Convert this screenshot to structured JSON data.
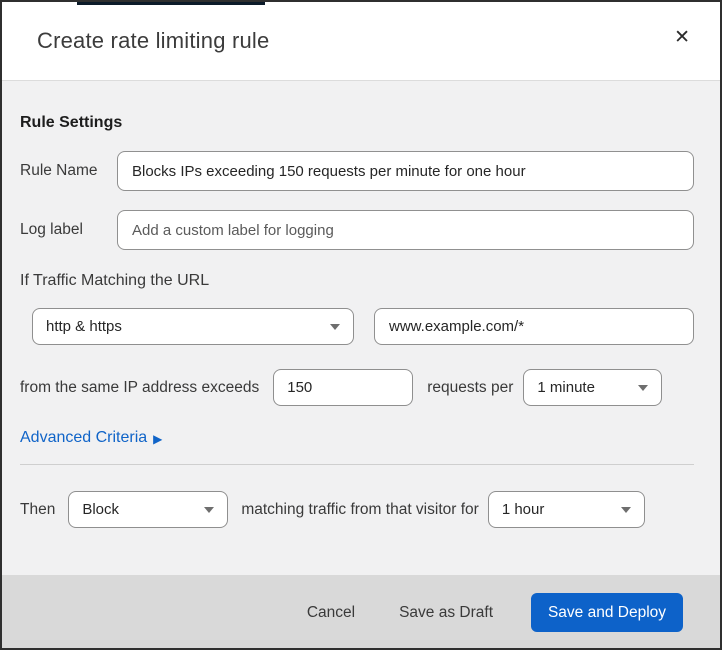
{
  "dialog": {
    "title": "Create rate limiting rule",
    "close_icon": "✕"
  },
  "rule_settings": {
    "section_heading": "Rule Settings",
    "rule_name": {
      "label": "Rule Name",
      "value": "Blocks IPs exceeding 150 requests per minute for one hour"
    },
    "log_label": {
      "label": "Log label",
      "placeholder": "Add a custom label for logging"
    },
    "traffic_match_heading": "If Traffic Matching the URL",
    "scheme_select": {
      "value": "http & https"
    },
    "url_input": {
      "value": "www.example.com/*"
    },
    "threshold": {
      "prefix_text": "from the same IP address exceeds",
      "count_value": "150",
      "middle_text": "requests per",
      "period_select": {
        "value": "1 minute"
      }
    },
    "advanced_criteria": {
      "label": "Advanced Criteria",
      "arrow_icon": "▶"
    },
    "then": {
      "prefix_text": "Then",
      "action_select": {
        "value": "Block"
      },
      "middle_text": "matching traffic from that visitor for",
      "duration_select": {
        "value": "1 hour"
      }
    }
  },
  "footer": {
    "cancel_label": "Cancel",
    "save_draft_label": "Save as Draft",
    "save_deploy_label": "Save and Deploy"
  },
  "colors": {
    "accent_blue": "#0d62c9",
    "link_blue": "#1064c8",
    "body_bg": "#f1f1f2",
    "footer_bg": "#d9d9d9",
    "top_strip": "#0c1b2a"
  }
}
